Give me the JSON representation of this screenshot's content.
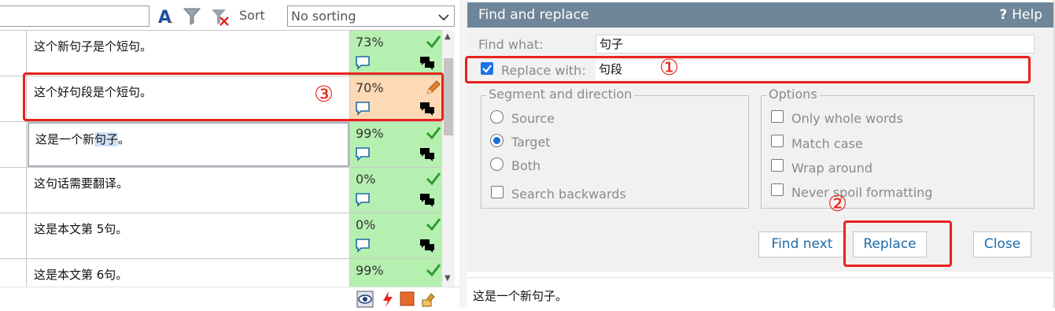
{
  "toolbar": {
    "icons": [
      "font-a-icon",
      "filter-icon",
      "clear-filter-icon"
    ],
    "sort_label": "Sort",
    "sort_selected": "No sorting"
  },
  "rows": [
    {
      "text": "这个新句子是个短句。",
      "percent": "73%",
      "status_color": "#b6f0b1",
      "status_icon": "check-icon"
    },
    {
      "text": "这个好句段是个短句。",
      "percent": "70%",
      "status_color": "#fdd9b5",
      "status_icon": "pencil-icon"
    },
    {
      "text_pre": "这是一个新",
      "text_hl": "句子",
      "text_post": "。",
      "percent": "99%",
      "status_color": "#b6f0b1",
      "status_icon": "check-icon"
    },
    {
      "text": "这句话需要翻译。",
      "percent": "0%",
      "status_color": "#b6f0b1",
      "status_icon": "check-icon"
    },
    {
      "text": "这是本文第 5句。",
      "percent": "0%",
      "status_color": "#b6f0b1",
      "status_icon": "check-icon"
    },
    {
      "text": "这是本文第 6句。",
      "percent": "99%",
      "status_color": "#b6f0b1",
      "status_icon": "check-icon"
    }
  ],
  "dialog": {
    "title": "Find and replace",
    "help": "Help",
    "find_label": "Find what:",
    "find_value": "句子",
    "replace_label": "Replace with:",
    "replace_value": "句段",
    "replace_checked": true,
    "segment_group": {
      "title": "Segment and direction",
      "options": [
        "Source",
        "Target",
        "Both"
      ],
      "selected": "Target",
      "search_backwards": "Search backwards"
    },
    "options_group": {
      "title": "Options",
      "items": [
        "Only whole words",
        "Match case",
        "Wrap around",
        "Never spoil formatting"
      ]
    },
    "buttons": {
      "find_next": "Find next",
      "replace": "Replace",
      "close": "Close"
    }
  },
  "status_text": "这是一个新句子。",
  "annotations": {
    "one": "①",
    "two": "②",
    "three": "③"
  },
  "colors": {
    "title_bar": "#6f8599",
    "button_text": "#1c6ca8",
    "annotation_red": "#e8231c",
    "accent_blue": "#1a73e8"
  }
}
